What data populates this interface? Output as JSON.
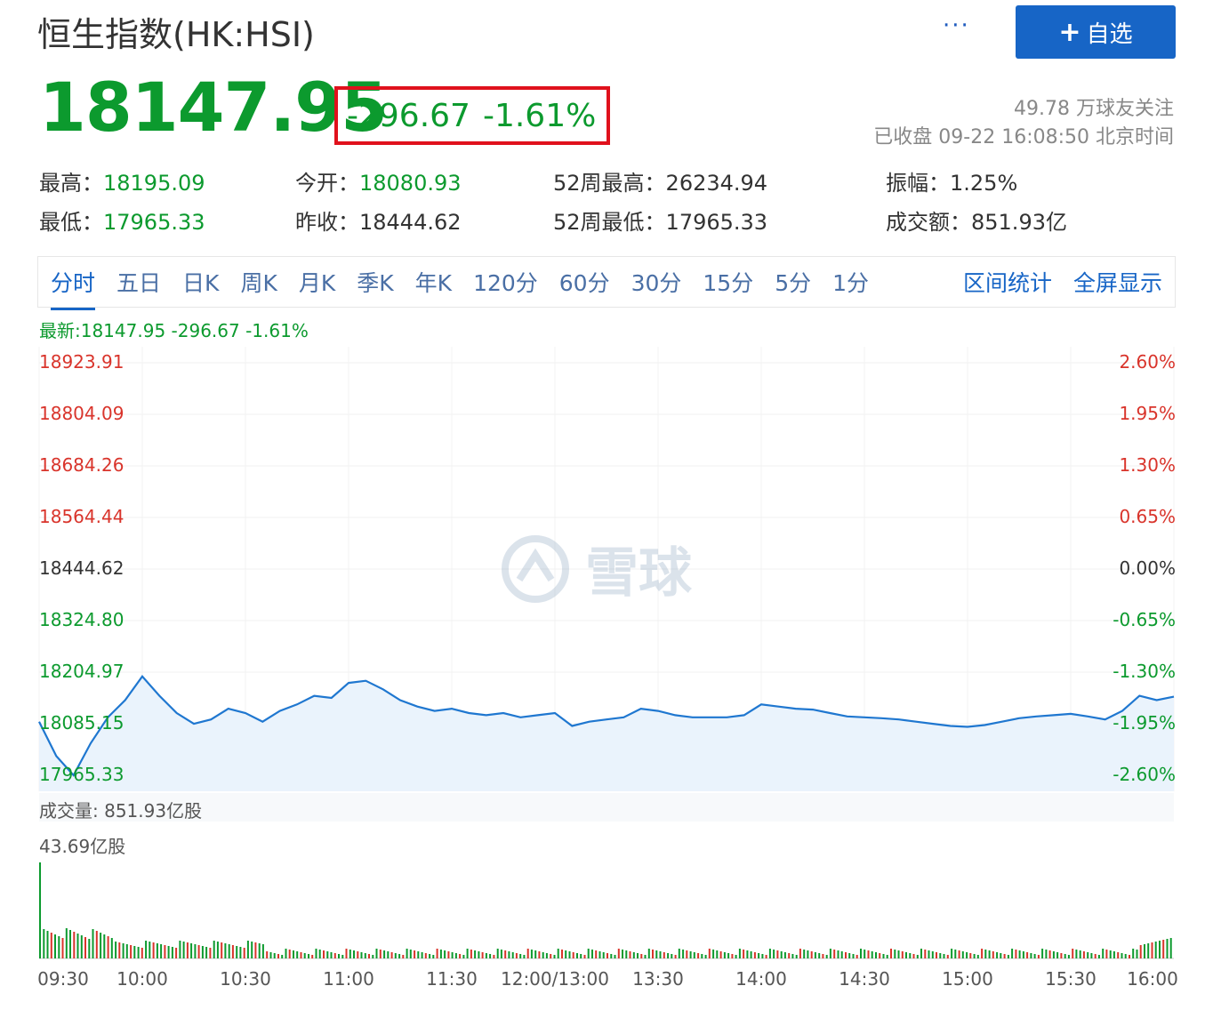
{
  "header": {
    "title": "恒生指数(HK:HSI)",
    "more_label": "···",
    "follow_label": "自选",
    "follow_plus": "+"
  },
  "quote": {
    "price": "18147.95",
    "change": "-296.67",
    "change_pct": "-1.61%",
    "followers": "49.78 万球友关注",
    "status": "已收盘 09-22 16:08:50 北京时间"
  },
  "stats": [
    {
      "label": "最高：",
      "value": "18195.09",
      "tone": "green"
    },
    {
      "label": "今开：",
      "value": "18080.93",
      "tone": "green"
    },
    {
      "label": "52周最高：",
      "value": "26234.94",
      "tone": "dark"
    },
    {
      "label": "振幅：",
      "value": "1.25%",
      "tone": "dark"
    },
    {
      "label": "最低：",
      "value": "17965.33",
      "tone": "green"
    },
    {
      "label": "昨收：",
      "value": "18444.62",
      "tone": "dark"
    },
    {
      "label": "52周最低：",
      "value": "17965.33",
      "tone": "dark"
    },
    {
      "label": "成交额：",
      "value": "851.93亿",
      "tone": "dark"
    }
  ],
  "tabs": [
    "分时",
    "五日",
    "日K",
    "周K",
    "月K",
    "季K",
    "年K",
    "120分",
    "60分",
    "30分",
    "15分",
    "5分",
    "1分"
  ],
  "tabs_right": [
    "区间统计",
    "全屏显示"
  ],
  "latest": "最新:18147.95 -296.67 -1.61%",
  "watermark": "雪球",
  "colors": {
    "up": "#d9342b",
    "down": "#0c9a2e",
    "line": "#1f77d0",
    "accent": "#1765c6"
  },
  "chart_data": {
    "type": "line",
    "base": 18444.62,
    "y_left_labels": [
      "18923.91",
      "18804.09",
      "18684.26",
      "18564.44",
      "18444.62",
      "18324.80",
      "18204.97",
      "18085.15",
      "17965.33"
    ],
    "y_right_labels": [
      "2.60%",
      "1.95%",
      "1.30%",
      "0.65%",
      "0.00%",
      "-0.65%",
      "-1.30%",
      "-1.95%",
      "-2.60%"
    ],
    "x_labels": [
      "09:30",
      "10:00",
      "10:30",
      "11:00",
      "11:30",
      "12:00/13:00",
      "13:30",
      "14:00",
      "14:30",
      "15:00",
      "15:30",
      "16:00"
    ],
    "price_series": [
      [
        "09:30",
        18090
      ],
      [
        "09:35",
        18010
      ],
      [
        "09:40",
        17965.33
      ],
      [
        "09:45",
        18040
      ],
      [
        "09:50",
        18100
      ],
      [
        "09:55",
        18140
      ],
      [
        "10:00",
        18195.09
      ],
      [
        "10:05",
        18150
      ],
      [
        "10:10",
        18110
      ],
      [
        "10:15",
        18085
      ],
      [
        "10:20",
        18095
      ],
      [
        "10:25",
        18120
      ],
      [
        "10:30",
        18110
      ],
      [
        "10:35",
        18090
      ],
      [
        "10:40",
        18115
      ],
      [
        "10:45",
        18130
      ],
      [
        "10:50",
        18150
      ],
      [
        "10:55",
        18145
      ],
      [
        "11:00",
        18180
      ],
      [
        "11:05",
        18185
      ],
      [
        "11:10",
        18165
      ],
      [
        "11:15",
        18140
      ],
      [
        "11:20",
        18125
      ],
      [
        "11:25",
        18115
      ],
      [
        "11:30",
        18120
      ],
      [
        "11:35",
        18110
      ],
      [
        "11:40",
        18105
      ],
      [
        "11:45",
        18110
      ],
      [
        "11:50",
        18100
      ],
      [
        "11:55",
        18105
      ],
      [
        "12:00/13:00",
        18110
      ],
      [
        "13:05",
        18080
      ],
      [
        "13:10",
        18090
      ],
      [
        "13:15",
        18095
      ],
      [
        "13:20",
        18100
      ],
      [
        "13:25",
        18120
      ],
      [
        "13:30",
        18115
      ],
      [
        "13:35",
        18105
      ],
      [
        "13:40",
        18100
      ],
      [
        "13:45",
        18100
      ],
      [
        "13:50",
        18100
      ],
      [
        "13:55",
        18105
      ],
      [
        "14:00",
        18130
      ],
      [
        "14:05",
        18125
      ],
      [
        "14:10",
        18120
      ],
      [
        "14:15",
        18118
      ],
      [
        "14:20",
        18110
      ],
      [
        "14:25",
        18102
      ],
      [
        "14:30",
        18100
      ],
      [
        "14:35",
        18098
      ],
      [
        "14:40",
        18095
      ],
      [
        "14:45",
        18090
      ],
      [
        "14:50",
        18085
      ],
      [
        "14:55",
        18080
      ],
      [
        "15:00",
        18078
      ],
      [
        "15:05",
        18082
      ],
      [
        "15:10",
        18090
      ],
      [
        "15:15",
        18098
      ],
      [
        "15:20",
        18102
      ],
      [
        "15:25",
        18105
      ],
      [
        "15:30",
        18108
      ],
      [
        "15:35",
        18102
      ],
      [
        "15:40",
        18095
      ],
      [
        "15:45",
        18115
      ],
      [
        "15:50",
        18150
      ],
      [
        "15:55",
        18140
      ],
      [
        "16:00",
        18147.95
      ]
    ],
    "volume_label": "成交量: 851.93亿股",
    "volume_max_label": "43.69亿股"
  }
}
